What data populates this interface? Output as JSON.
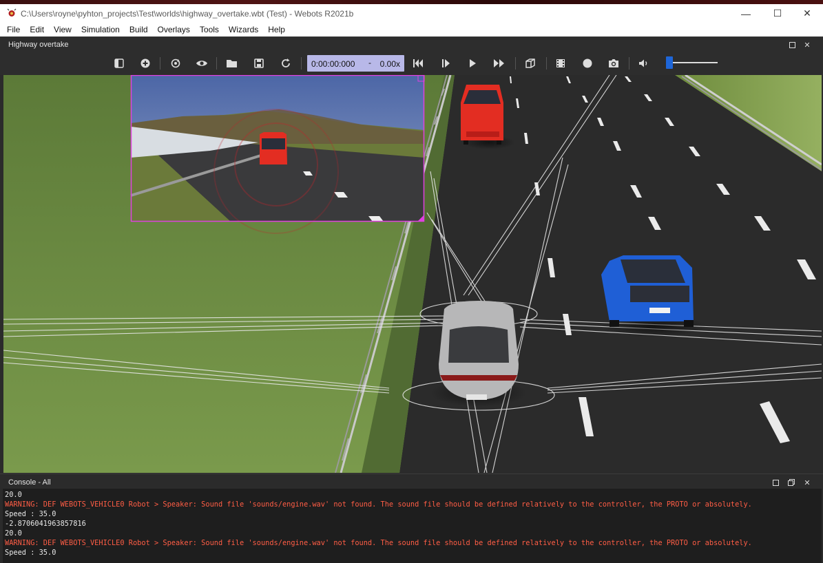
{
  "window": {
    "title": "C:\\Users\\royne\\pyhton_projects\\Test\\worlds\\highway_overtake.wbt (Test) - Webots R2021b",
    "minimize_glyph": "—",
    "maximize_glyph": "☐",
    "close_glyph": "✕"
  },
  "menu": [
    "File",
    "Edit",
    "View",
    "Simulation",
    "Build",
    "Overlays",
    "Tools",
    "Wizards",
    "Help"
  ],
  "view": {
    "title": "Highway overtake",
    "restore_glyph": "▫",
    "close_glyph": "✕"
  },
  "toolbar": {
    "time": "0:00:00:000",
    "speed_sep": "-",
    "speed": "0.00x",
    "volume_level": 0.05,
    "icons": [
      "scene-tree-toggle-icon",
      "add-node-icon",
      "reset-viewpoint-icon",
      "view-eye-icon",
      "open-world-icon",
      "save-world-icon",
      "reload-world-icon",
      "reset-simulation-icon",
      "step-icon",
      "play-icon",
      "fast-forward-icon",
      "3d-view-icon",
      "record-movie-icon",
      "record-icon",
      "screenshot-icon",
      "sound-icon"
    ]
  },
  "console": {
    "title": "Console - All",
    "lines": [
      {
        "text": "20.0",
        "type": "normal"
      },
      {
        "text": "WARNING: DEF WEBOTS_VEHICLE0 Robot > Speaker: Sound file 'sounds/engine.wav' not found. The sound file should be defined relatively to the controller, the PROTO or absolutely.",
        "type": "warn"
      },
      {
        "text": "Speed : 35.0",
        "type": "normal"
      },
      {
        "text": "-2.8706041963857816",
        "type": "normal"
      },
      {
        "text": "20.0",
        "type": "normal"
      },
      {
        "text": "WARNING: DEF WEBOTS_VEHICLE0 Robot > Speaker: Sound file 'sounds/engine.wav' not found. The sound file should be defined relatively to the controller, the PROTO or absolutely.",
        "type": "warn"
      },
      {
        "text": "Speed : 35.0",
        "type": "normal"
      }
    ]
  },
  "colors": {
    "accent": "#1e66d8",
    "warning": "#ff5d45",
    "time_box": "#b8b8e8",
    "camera_overlay_border": "#e040e0"
  }
}
